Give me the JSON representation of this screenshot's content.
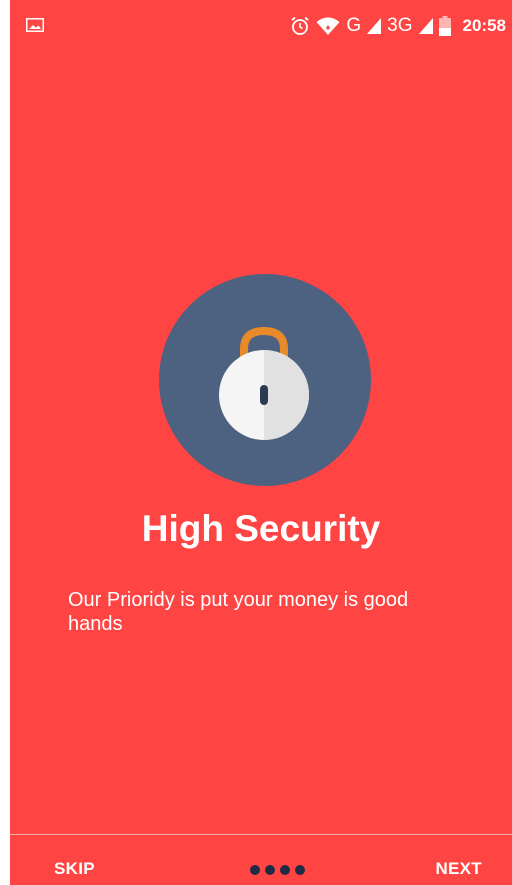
{
  "status_bar": {
    "icons": [
      "gallery-icon",
      "alarm-icon",
      "wifi-icon",
      "signal-icon",
      "signal-icon",
      "battery-icon"
    ],
    "network_1": "G",
    "network_2": "3G",
    "time": "20:58"
  },
  "onboarding": {
    "illustration": "unlocked-padlock-icon",
    "title": "High Security",
    "description": "Our Prioridy is put your money is good hands"
  },
  "footer": {
    "skip_label": "SKIP",
    "next_label": "NEXT",
    "page_count": 4
  },
  "colors": {
    "background": "#ff4444",
    "circle": "#4d6180",
    "shackle": "#e8892a",
    "dots": "#1f2a44"
  }
}
